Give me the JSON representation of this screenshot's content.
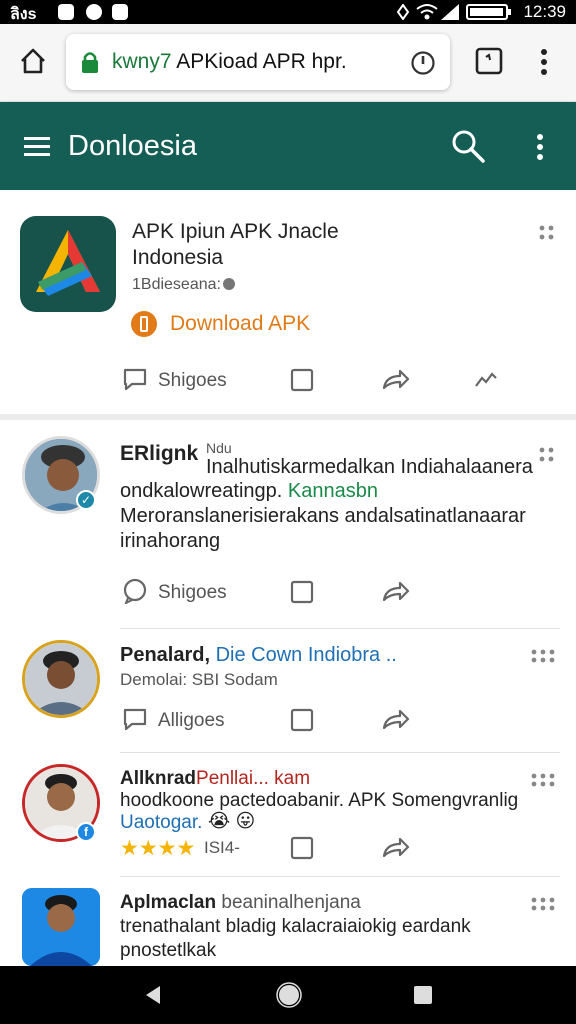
{
  "status_bar": {
    "carrier": "ลิงs",
    "time": "12:39"
  },
  "browser": {
    "url_host": "kwny7",
    "url_rest": " APKioad APR hpr."
  },
  "app_bar": {
    "title": "Donloesia"
  },
  "featured": {
    "title_line1": "APK Ipiun APK Jnacle",
    "title_line2": "Indonesia",
    "meta": "1Bdieseana:",
    "download_label": "Download APK",
    "share_label": "Shigoes"
  },
  "posts": [
    {
      "author": "ERlignk",
      "author_extra": "Ndu",
      "line1": "Inalhutiskarmedalkan Indiahalaanera",
      "line2a": "ondkalowreatingp.",
      "line2b": "Kannasbn",
      "line3": "Meroranslanerisierakans andalsatinatlanaarar",
      "line4": "irinahorang",
      "action_label": "Shigoes"
    },
    {
      "author": "Penalard,",
      "author_link": "Die Cown Indiobra ..",
      "meta": "Demolai: SBI Sodam",
      "action_label": "Alligoes"
    },
    {
      "author": "Allknrad",
      "author_link": "Penllai... kam",
      "line1": "hoodkoone pactedoabanir. APK Somengvranlig",
      "line2": "Uaotogar.",
      "rating_label": "ISI4-",
      "stars": 4,
      "emoji": "😭 😛"
    },
    {
      "author": "Aplmaclan",
      "author_extra": "beaninalhenjana",
      "line1": "trenathalant bladig kalacraiaiokig eardank",
      "line2": "pnostetlkak"
    }
  ],
  "colors": {
    "app_bar": "#155e55",
    "accent_orange": "#e07b18",
    "status_bar": "#000000"
  }
}
